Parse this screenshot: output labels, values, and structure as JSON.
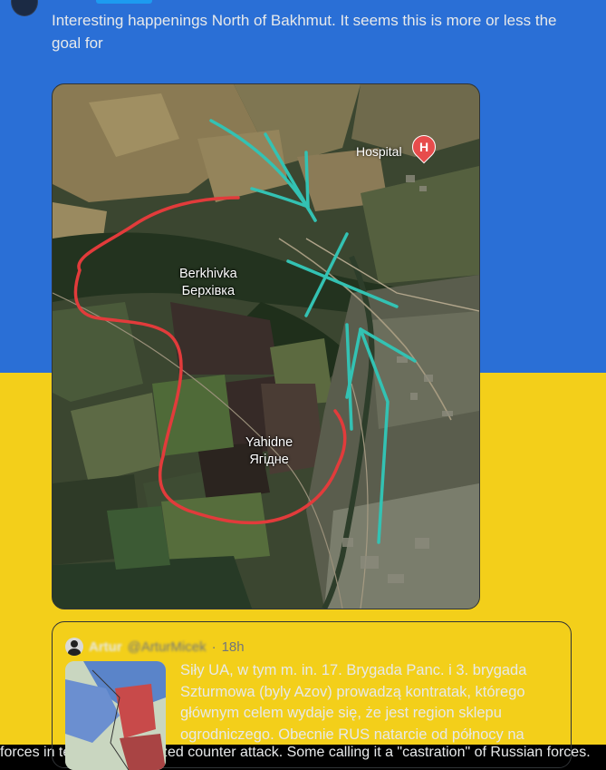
{
  "tweet": {
    "text_part1": "Interesting happenings North of Bakhmut. It seems this is more or less the goal for",
    "text_part2": "forces in terms of a localized counter attack. Some calling it a \"castration\" of Russian forces.",
    "flag_icon": "ukraine-flag-icon"
  },
  "map": {
    "labels": {
      "hospital": "Hospital",
      "hospital_pin": "H",
      "berkhivka_en": "Berkhivka",
      "berkhivka_uk": "Берхівка",
      "yahidne_en": "Yahidne",
      "yahidne_uk": "Ягідне"
    },
    "colors": {
      "encirclement": "#e23b3b",
      "arrows": "#33c2b3",
      "hospital_pin": "#e74c4c"
    }
  },
  "quote": {
    "author_name": "Artur",
    "author_handle": "@ArturMicek",
    "separator": "·",
    "time": "18h",
    "text": "Siły UA, w tym m. in. 17. Brygada Panc. i 3. brygada Szturmowa (byly Azov) prowadzą kontratak, którego głównym celem wydaje się, że jest region sklepu ogrodniczego. Obecnie RUS natarcie od północy na"
  },
  "colors": {
    "accent": "#1d9bf0",
    "background": "#000000",
    "text": "#e7e9ea",
    "muted": "#71767b"
  }
}
